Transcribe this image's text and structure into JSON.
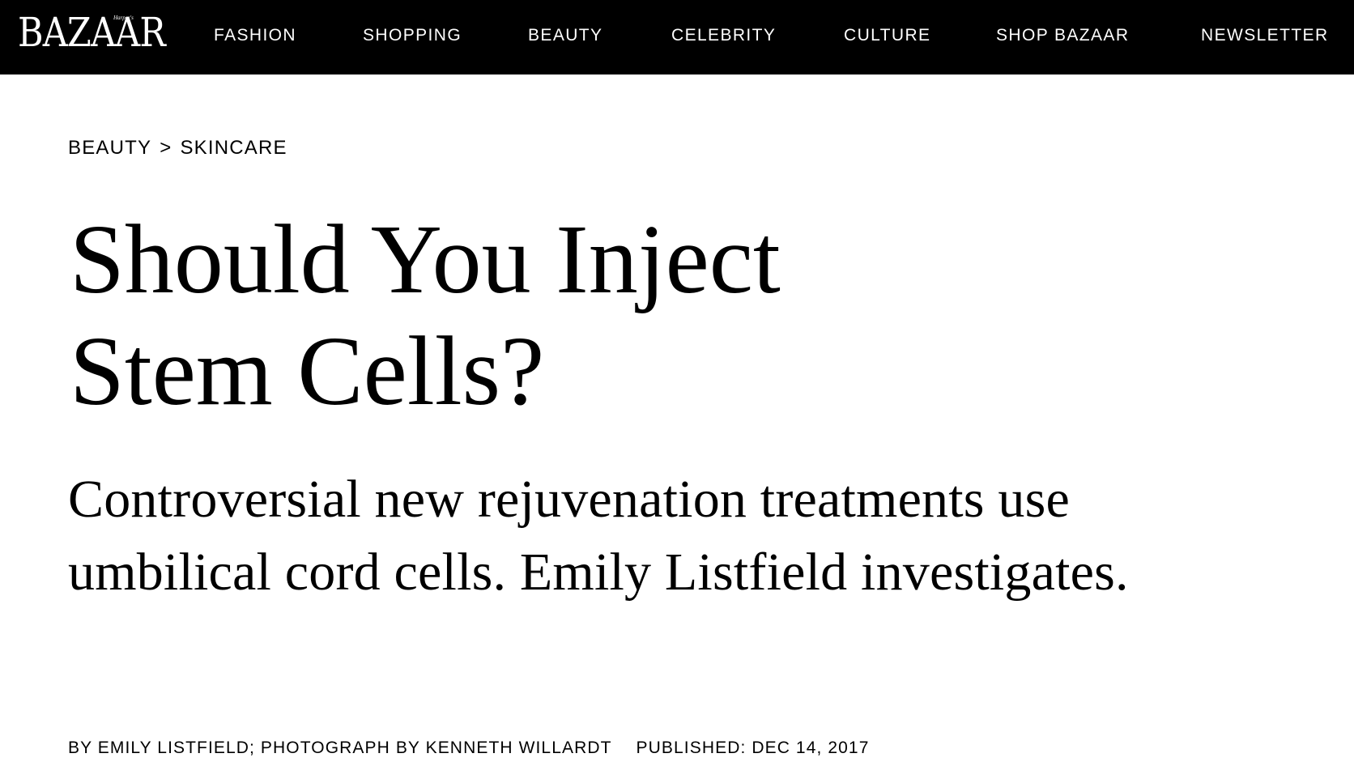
{
  "header": {
    "logo_text": "BAZAAR",
    "logo_superscript": "Harper's",
    "nav_items": [
      "FASHION",
      "SHOPPING",
      "BEAUTY",
      "CELEBRITY",
      "CULTURE",
      "SHOP BAZAAR",
      "NEWSLETTER"
    ]
  },
  "breadcrumb": {
    "section": "BEAUTY",
    "separator": ">",
    "subsection": "SKINCARE"
  },
  "article": {
    "headline_line1": "Should You Inject",
    "headline_line2": "Stem Cells?",
    "dek": "Controversial new rejuvenation treatments use umbilical cord cells. Emily Listfield investigates.",
    "byline": "BY EMILY LISTFIELD; PHOTOGRAPH BY KENNETH WILLARDT",
    "published": "PUBLISHED: DEC 14, 2017"
  },
  "colors": {
    "nav_background": "#000000",
    "nav_text": "#ffffff",
    "page_background": "#ffffff",
    "body_text": "#000000"
  }
}
